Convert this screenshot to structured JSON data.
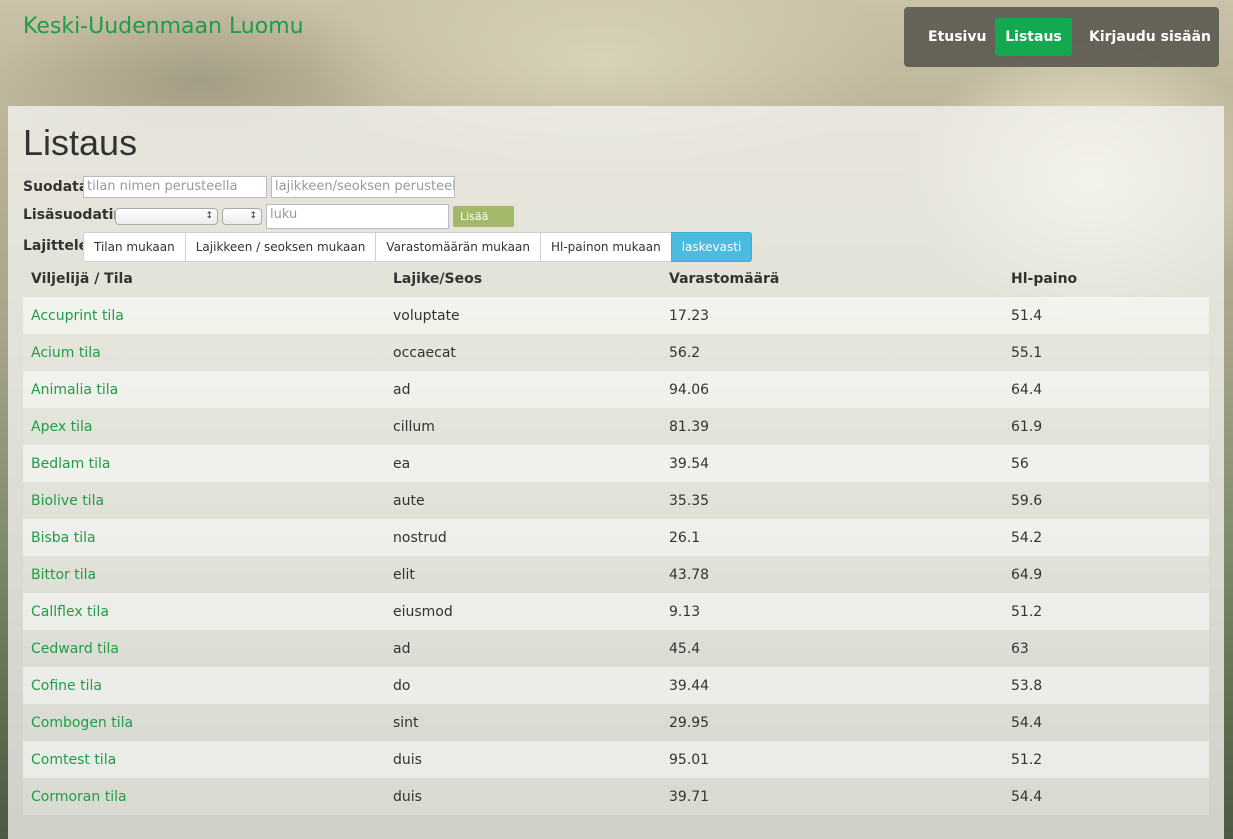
{
  "brand": "Keski-Uudenmaan Luomu",
  "nav": {
    "home": "Etusivu",
    "list": "Listaus",
    "login": "Kirjaudu sisään"
  },
  "page_title": "Listaus",
  "filter": {
    "label": "Suodata",
    "farm_placeholder": "tilan nimen perusteella",
    "variety_placeholder": "lajikkeen/seoksen perusteella"
  },
  "extra_filter": {
    "label": "Lisäsuodatin",
    "number_placeholder": "luku",
    "add_label": "Lisää suodatin"
  },
  "sort": {
    "label": "Lajittele",
    "options": [
      "Tilan mukaan",
      "Lajikkeen / seoksen mukaan",
      "Varastomäärän mukaan",
      "Hl-painon mukaan"
    ],
    "direction": "laskevasti"
  },
  "table": {
    "headers": [
      "Viljelijä / Tila",
      "Lajike/Seos",
      "Varastomäärä",
      "Hl-paino"
    ],
    "rows": [
      [
        "Accuprint tila",
        "voluptate",
        "17.23",
        "51.4"
      ],
      [
        "Acium tila",
        "occaecat",
        "56.2",
        "55.1"
      ],
      [
        "Animalia tila",
        "ad",
        "94.06",
        "64.4"
      ],
      [
        "Apex tila",
        "cillum",
        "81.39",
        "61.9"
      ],
      [
        "Bedlam tila",
        "ea",
        "39.54",
        "56"
      ],
      [
        "Biolive tila",
        "aute",
        "35.35",
        "59.6"
      ],
      [
        "Bisba tila",
        "nostrud",
        "26.1",
        "54.2"
      ],
      [
        "Bittor tila",
        "elit",
        "43.78",
        "64.9"
      ],
      [
        "Callflex tila",
        "eiusmod",
        "9.13",
        "51.2"
      ],
      [
        "Cedward tila",
        "ad",
        "45.4",
        "63"
      ],
      [
        "Cofine tila",
        "do",
        "39.44",
        "53.8"
      ],
      [
        "Combogen tila",
        "sint",
        "29.95",
        "54.4"
      ],
      [
        "Comtest tila",
        "duis",
        "95.01",
        "51.2"
      ],
      [
        "Cormoran tila",
        "duis",
        "39.71",
        "54.4"
      ]
    ]
  },
  "colors": {
    "brand_green": "#1f9d46",
    "nav_active": "#14a850",
    "sort_active": "#4bbce0",
    "add_button": "#a4b86a"
  }
}
